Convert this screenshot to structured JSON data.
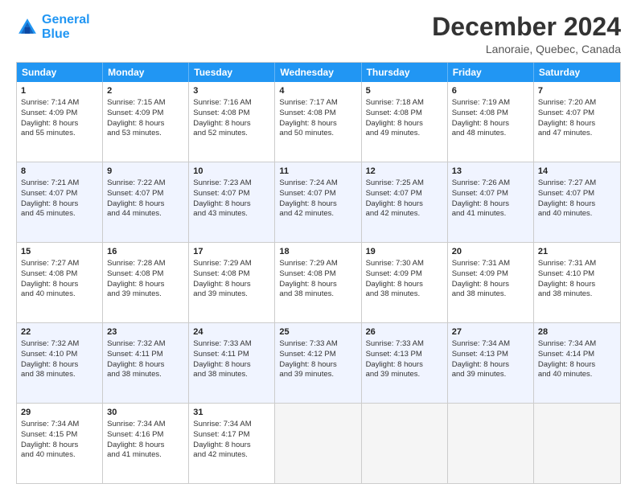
{
  "logo": {
    "line1": "General",
    "line2": "Blue"
  },
  "title": "December 2024",
  "location": "Lanoraie, Quebec, Canada",
  "days_of_week": [
    "Sunday",
    "Monday",
    "Tuesday",
    "Wednesday",
    "Thursday",
    "Friday",
    "Saturday"
  ],
  "weeks": [
    {
      "alt": false,
      "cells": [
        {
          "day": "1",
          "lines": [
            "Sunrise: 7:14 AM",
            "Sunset: 4:09 PM",
            "Daylight: 8 hours",
            "and 55 minutes."
          ]
        },
        {
          "day": "2",
          "lines": [
            "Sunrise: 7:15 AM",
            "Sunset: 4:09 PM",
            "Daylight: 8 hours",
            "and 53 minutes."
          ]
        },
        {
          "day": "3",
          "lines": [
            "Sunrise: 7:16 AM",
            "Sunset: 4:08 PM",
            "Daylight: 8 hours",
            "and 52 minutes."
          ]
        },
        {
          "day": "4",
          "lines": [
            "Sunrise: 7:17 AM",
            "Sunset: 4:08 PM",
            "Daylight: 8 hours",
            "and 50 minutes."
          ]
        },
        {
          "day": "5",
          "lines": [
            "Sunrise: 7:18 AM",
            "Sunset: 4:08 PM",
            "Daylight: 8 hours",
            "and 49 minutes."
          ]
        },
        {
          "day": "6",
          "lines": [
            "Sunrise: 7:19 AM",
            "Sunset: 4:08 PM",
            "Daylight: 8 hours",
            "and 48 minutes."
          ]
        },
        {
          "day": "7",
          "lines": [
            "Sunrise: 7:20 AM",
            "Sunset: 4:07 PM",
            "Daylight: 8 hours",
            "and 47 minutes."
          ]
        }
      ]
    },
    {
      "alt": true,
      "cells": [
        {
          "day": "8",
          "lines": [
            "Sunrise: 7:21 AM",
            "Sunset: 4:07 PM",
            "Daylight: 8 hours",
            "and 45 minutes."
          ]
        },
        {
          "day": "9",
          "lines": [
            "Sunrise: 7:22 AM",
            "Sunset: 4:07 PM",
            "Daylight: 8 hours",
            "and 44 minutes."
          ]
        },
        {
          "day": "10",
          "lines": [
            "Sunrise: 7:23 AM",
            "Sunset: 4:07 PM",
            "Daylight: 8 hours",
            "and 43 minutes."
          ]
        },
        {
          "day": "11",
          "lines": [
            "Sunrise: 7:24 AM",
            "Sunset: 4:07 PM",
            "Daylight: 8 hours",
            "and 42 minutes."
          ]
        },
        {
          "day": "12",
          "lines": [
            "Sunrise: 7:25 AM",
            "Sunset: 4:07 PM",
            "Daylight: 8 hours",
            "and 42 minutes."
          ]
        },
        {
          "day": "13",
          "lines": [
            "Sunrise: 7:26 AM",
            "Sunset: 4:07 PM",
            "Daylight: 8 hours",
            "and 41 minutes."
          ]
        },
        {
          "day": "14",
          "lines": [
            "Sunrise: 7:27 AM",
            "Sunset: 4:07 PM",
            "Daylight: 8 hours",
            "and 40 minutes."
          ]
        }
      ]
    },
    {
      "alt": false,
      "cells": [
        {
          "day": "15",
          "lines": [
            "Sunrise: 7:27 AM",
            "Sunset: 4:08 PM",
            "Daylight: 8 hours",
            "and 40 minutes."
          ]
        },
        {
          "day": "16",
          "lines": [
            "Sunrise: 7:28 AM",
            "Sunset: 4:08 PM",
            "Daylight: 8 hours",
            "and 39 minutes."
          ]
        },
        {
          "day": "17",
          "lines": [
            "Sunrise: 7:29 AM",
            "Sunset: 4:08 PM",
            "Daylight: 8 hours",
            "and 39 minutes."
          ]
        },
        {
          "day": "18",
          "lines": [
            "Sunrise: 7:29 AM",
            "Sunset: 4:08 PM",
            "Daylight: 8 hours",
            "and 38 minutes."
          ]
        },
        {
          "day": "19",
          "lines": [
            "Sunrise: 7:30 AM",
            "Sunset: 4:09 PM",
            "Daylight: 8 hours",
            "and 38 minutes."
          ]
        },
        {
          "day": "20",
          "lines": [
            "Sunrise: 7:31 AM",
            "Sunset: 4:09 PM",
            "Daylight: 8 hours",
            "and 38 minutes."
          ]
        },
        {
          "day": "21",
          "lines": [
            "Sunrise: 7:31 AM",
            "Sunset: 4:10 PM",
            "Daylight: 8 hours",
            "and 38 minutes."
          ]
        }
      ]
    },
    {
      "alt": true,
      "cells": [
        {
          "day": "22",
          "lines": [
            "Sunrise: 7:32 AM",
            "Sunset: 4:10 PM",
            "Daylight: 8 hours",
            "and 38 minutes."
          ]
        },
        {
          "day": "23",
          "lines": [
            "Sunrise: 7:32 AM",
            "Sunset: 4:11 PM",
            "Daylight: 8 hours",
            "and 38 minutes."
          ]
        },
        {
          "day": "24",
          "lines": [
            "Sunrise: 7:33 AM",
            "Sunset: 4:11 PM",
            "Daylight: 8 hours",
            "and 38 minutes."
          ]
        },
        {
          "day": "25",
          "lines": [
            "Sunrise: 7:33 AM",
            "Sunset: 4:12 PM",
            "Daylight: 8 hours",
            "and 39 minutes."
          ]
        },
        {
          "day": "26",
          "lines": [
            "Sunrise: 7:33 AM",
            "Sunset: 4:13 PM",
            "Daylight: 8 hours",
            "and 39 minutes."
          ]
        },
        {
          "day": "27",
          "lines": [
            "Sunrise: 7:34 AM",
            "Sunset: 4:13 PM",
            "Daylight: 8 hours",
            "and 39 minutes."
          ]
        },
        {
          "day": "28",
          "lines": [
            "Sunrise: 7:34 AM",
            "Sunset: 4:14 PM",
            "Daylight: 8 hours",
            "and 40 minutes."
          ]
        }
      ]
    },
    {
      "alt": false,
      "cells": [
        {
          "day": "29",
          "lines": [
            "Sunrise: 7:34 AM",
            "Sunset: 4:15 PM",
            "Daylight: 8 hours",
            "and 40 minutes."
          ]
        },
        {
          "day": "30",
          "lines": [
            "Sunrise: 7:34 AM",
            "Sunset: 4:16 PM",
            "Daylight: 8 hours",
            "and 41 minutes."
          ]
        },
        {
          "day": "31",
          "lines": [
            "Sunrise: 7:34 AM",
            "Sunset: 4:17 PM",
            "Daylight: 8 hours",
            "and 42 minutes."
          ]
        },
        {
          "day": "",
          "lines": []
        },
        {
          "day": "",
          "lines": []
        },
        {
          "day": "",
          "lines": []
        },
        {
          "day": "",
          "lines": []
        }
      ]
    }
  ]
}
